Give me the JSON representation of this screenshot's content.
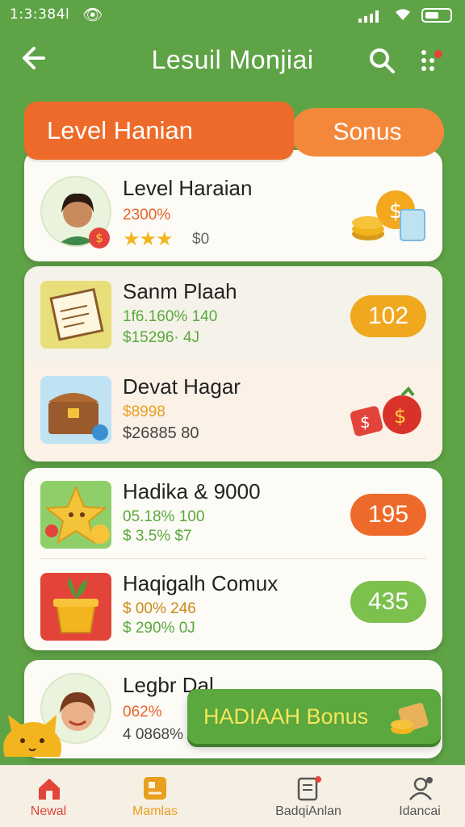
{
  "status_bar": {
    "time": "1:3:384l"
  },
  "header": {
    "title": "Lesuil Monjiai"
  },
  "tabs": [
    {
      "label": "Level Hanian"
    },
    {
      "label": "Sonus"
    }
  ],
  "featured": {
    "name": "Level Haraian",
    "percent": "2300%",
    "rating_stars": 3,
    "rating_note": "$0"
  },
  "items": [
    {
      "name": "Sanm Plaah",
      "line1": "1f6.160% 140",
      "line2": "$15296· 4J",
      "badge": "102",
      "badge_color": "#f0a81e"
    },
    {
      "name": "Devat Hagar",
      "line1": "$8998",
      "line2": "$26885 80"
    },
    {
      "name": "Hadika & 9000",
      "line1": "05.18% 100",
      "line2": "$ 3.5% $7",
      "badge": "195",
      "badge_color": "#ee6a2a"
    },
    {
      "name": "Haqigalh Comux",
      "line1": "$ 00% 246",
      "line2": "$ 290% 0J",
      "badge": "435",
      "badge_color": "#7cc04d"
    },
    {
      "name": "Legbr Dal",
      "line1": "062%",
      "line2": "4 0868%"
    }
  ],
  "bonus_button": {
    "label": "HADIAAH Bonus"
  },
  "bottom_nav": [
    {
      "label": "Newal",
      "color": "#e2443a"
    },
    {
      "label": "Mamlas",
      "color": "#e79f1f"
    },
    {
      "label": "BadqiAnlan",
      "color": "#555555"
    },
    {
      "label": "Idancai",
      "color": "#555555"
    }
  ]
}
